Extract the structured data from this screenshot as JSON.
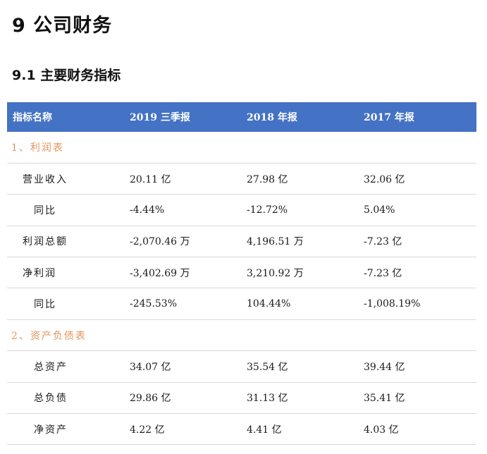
{
  "heading": "9 公司财务",
  "subheading": "9.1 主要财务指标",
  "table": {
    "headers": [
      "指标名称",
      "2019 三季报",
      "2018 年报",
      "2017 年报"
    ],
    "sections": [
      {
        "title": "1、利润表",
        "rows": [
          {
            "label": "营业收入",
            "values": [
              "20.11 亿",
              "27.98 亿",
              "32.06 亿"
            ]
          },
          {
            "label": "同比",
            "values": [
              "-4.44%",
              "-12.72%",
              "5.04%"
            ]
          },
          {
            "label": "利润总额",
            "values": [
              "-2,070.46 万",
              "4,196.51 万",
              "-7.23 亿"
            ]
          },
          {
            "label": "净利润",
            "values": [
              "-3,402.69 万",
              "3,210.92 万",
              "-7.23 亿"
            ]
          },
          {
            "label": "同比",
            "values": [
              "-245.53%",
              "104.44%",
              "-1,008.19%"
            ]
          }
        ]
      },
      {
        "title": "2、资产负债表",
        "rows": [
          {
            "label": "总资产",
            "values": [
              "34.07 亿",
              "35.54 亿",
              "39.44 亿"
            ]
          },
          {
            "label": "总负债",
            "values": [
              "29.86 亿",
              "31.13 亿",
              "35.41 亿"
            ]
          },
          {
            "label": "净资产",
            "values": [
              "4.22 亿",
              "4.41 亿",
              "4.03 亿"
            ]
          }
        ]
      }
    ]
  }
}
